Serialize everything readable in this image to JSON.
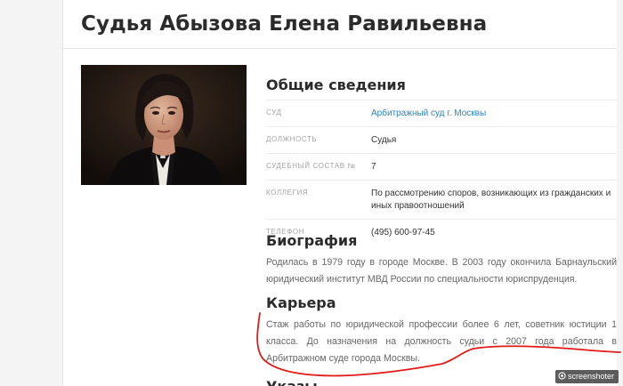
{
  "page": {
    "title": "Судья Абызова Елена Равильевна"
  },
  "photo": {
    "subject": "judge-portrait"
  },
  "general": {
    "heading": "Общие сведения",
    "rows": [
      {
        "key": "СУД",
        "value": "Арбитражный суд г. Москвы",
        "link": true
      },
      {
        "key": "ДОЛЖНОСТЬ",
        "value": "Судья",
        "link": false
      },
      {
        "key": "СУДЕБНЫЙ СОСТАВ №",
        "value": "7",
        "link": false
      },
      {
        "key": "КОЛЛЕГИЯ",
        "value": "По рассмотрению споров, возникающих из гражданских и иных правоотношений",
        "link": false
      },
      {
        "key": "ТЕЛЕФОН",
        "value": "(495) 600-97-45",
        "link": false
      }
    ]
  },
  "biography": {
    "heading": "Биография",
    "text": "Родилась в 1979 году в городе Москве. В 2003 году окончила Барнаульский юридический институт МВД России по специальности юриспруденция."
  },
  "career": {
    "heading": "Карьера",
    "text": "Стаж работы по юридической профессии более 6 лет, советник юстиции 1 класса. До назначения на должность судьи с 2007 года работала в Арбитражном суде города Москвы."
  },
  "next_section": {
    "heading": "Указы"
  },
  "watermark": {
    "text": "screenshoter"
  },
  "colors": {
    "link": "#2a86c5",
    "annotation": "#e21a1a"
  }
}
